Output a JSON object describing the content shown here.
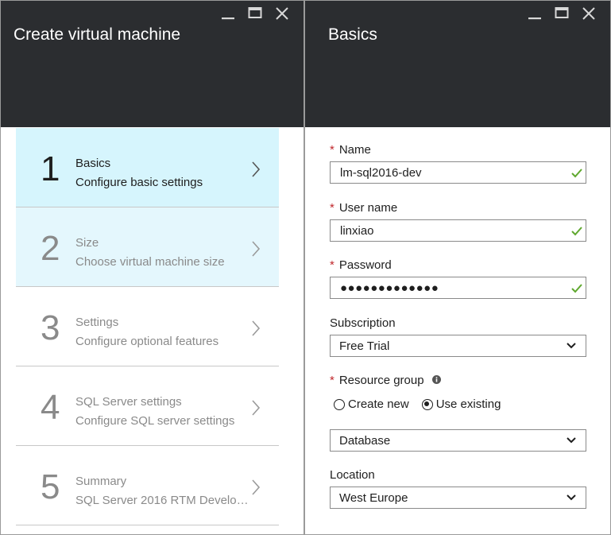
{
  "left_blade": {
    "title": "Create virtual machine",
    "steps": [
      {
        "number": "1",
        "title": "Basics",
        "subtitle": "Configure basic settings",
        "state": "active"
      },
      {
        "number": "2",
        "title": "Size",
        "subtitle": "Choose virtual machine size",
        "state": "visited"
      },
      {
        "number": "3",
        "title": "Settings",
        "subtitle": "Configure optional features",
        "state": "default"
      },
      {
        "number": "4",
        "title": "SQL Server settings",
        "subtitle": "Configure SQL server settings",
        "state": "default"
      },
      {
        "number": "5",
        "title": "Summary",
        "subtitle": "SQL Server 2016 RTM Develop...",
        "state": "default"
      }
    ]
  },
  "right_blade": {
    "title": "Basics",
    "form": {
      "name": {
        "label": "Name",
        "value": "lm-sql2016-dev",
        "required": "*"
      },
      "user_name": {
        "label": "User name",
        "value": "linxiao",
        "required": "*"
      },
      "password": {
        "label": "Password",
        "value": "●●●●●●●●●●●●●",
        "required": "*"
      },
      "subscription": {
        "label": "Subscription",
        "value": "Free Trial"
      },
      "resource_group": {
        "label": "Resource group",
        "required": "*",
        "options": [
          "Create new",
          "Use existing"
        ],
        "selected": "Use existing",
        "value": "Database"
      },
      "location": {
        "label": "Location",
        "value": "West Europe"
      }
    }
  },
  "colors": {
    "header_bg": "#2b2d30",
    "active_step_bg": "#d6f5fd",
    "visited_step_bg": "#e4f7fd",
    "required_star": "#c0282c",
    "valid_check": "#5fa82e"
  },
  "icons": [
    "minimize-icon",
    "maximize-icon",
    "close-icon",
    "chevron-right-icon",
    "checkmark-icon",
    "chevron-down-icon",
    "info-icon"
  ]
}
